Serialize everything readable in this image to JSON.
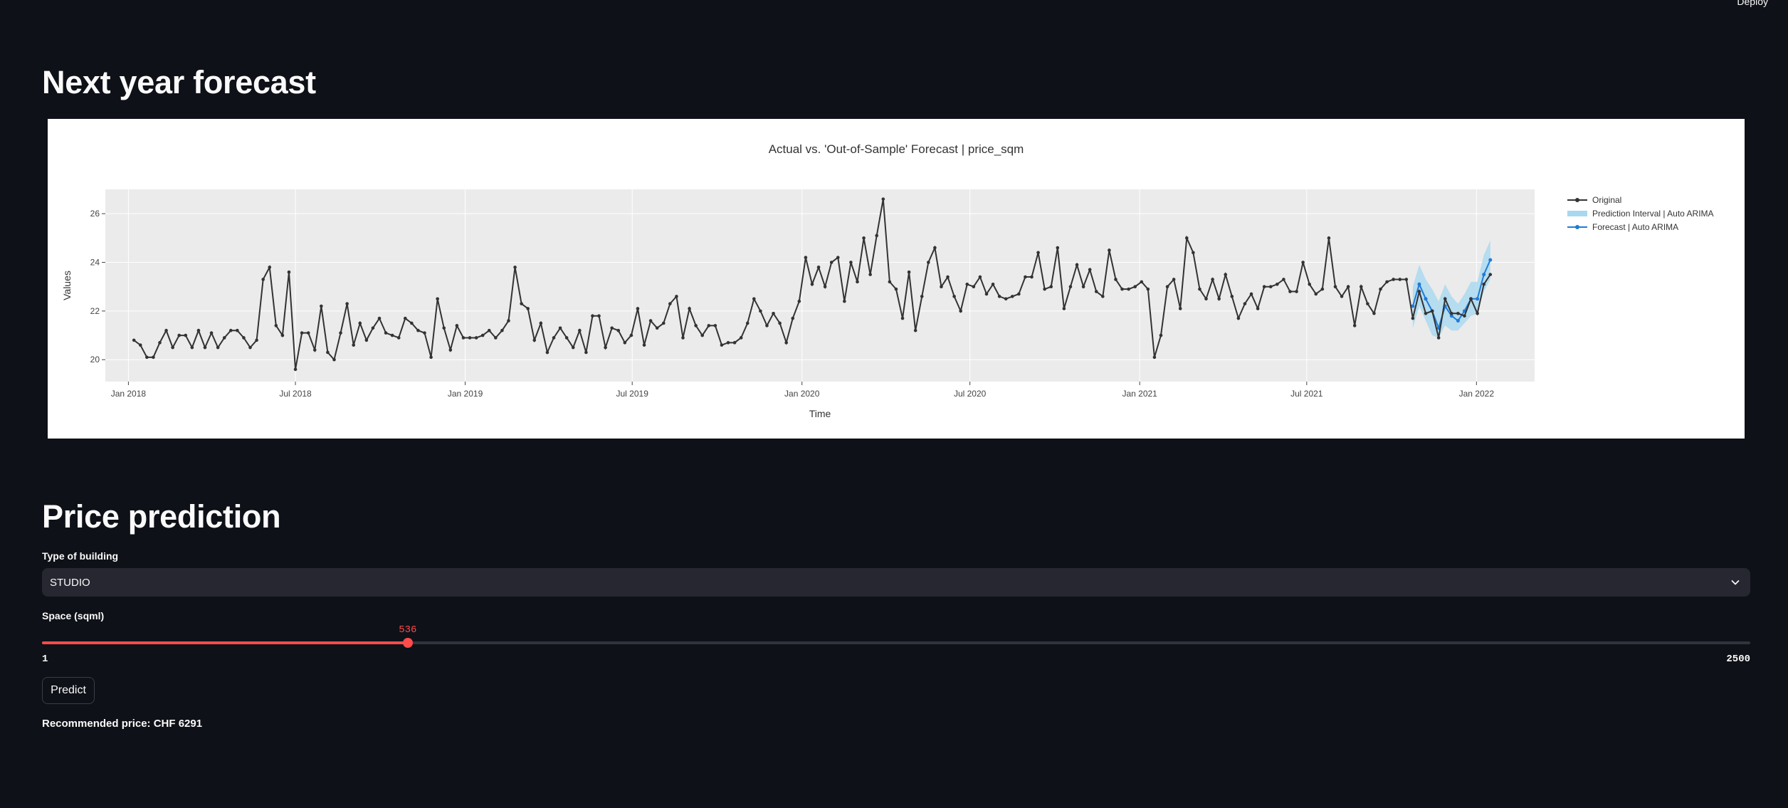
{
  "header": {
    "deploy_label": "Deploy"
  },
  "forecast_section": {
    "title": "Next year forecast"
  },
  "chart_data": {
    "type": "line",
    "title": "Actual vs. 'Out-of-Sample' Forecast | price_sqm",
    "xlabel": "Time",
    "ylabel": "Values",
    "x_ticks": [
      "Jan 2018",
      "Jul 2018",
      "Jan 2019",
      "Jul 2019",
      "Jan 2020",
      "Jul 2020",
      "Jan 2021",
      "Jul 2021",
      "Jan 2022"
    ],
    "y_ticks": [
      20,
      22,
      24,
      26
    ],
    "ylim": [
      19.1,
      27.0
    ],
    "xlim": [
      "2017-12-07",
      "2022-03-05"
    ],
    "x_unit": "week",
    "grid": true,
    "legend_position": "top-right",
    "legend_entries": [
      "Original",
      "Prediction Interval | Auto ARIMA",
      "Forecast | Auto ARIMA"
    ],
    "colors": {
      "original": "#333333",
      "interval": "#a8d8f0",
      "forecast": "#1f7bd8",
      "plot_bg": "#ebebeb"
    },
    "series": [
      {
        "name": "Original",
        "start": "2018-01-07",
        "values": [
          20.8,
          20.6,
          20.1,
          20.1,
          20.7,
          21.2,
          20.5,
          21.0,
          21.0,
          20.5,
          21.2,
          20.5,
          21.1,
          20.5,
          20.9,
          21.2,
          21.2,
          20.9,
          20.5,
          20.8,
          23.3,
          23.8,
          21.4,
          21.0,
          23.6,
          19.6,
          21.1,
          21.1,
          20.4,
          22.2,
          20.3,
          20.0,
          21.1,
          22.3,
          20.6,
          21.5,
          20.8,
          21.3,
          21.7,
          21.1,
          21.0,
          20.9,
          21.7,
          21.5,
          21.2,
          21.1,
          20.1,
          22.5,
          21.3,
          20.4,
          21.4,
          20.9,
          20.9,
          20.9,
          21.0,
          21.2,
          20.9,
          21.2,
          21.6,
          23.8,
          22.3,
          22.1,
          20.8,
          21.5,
          20.3,
          20.9,
          21.3,
          20.9,
          20.5,
          21.2,
          20.3,
          21.8,
          21.8,
          20.5,
          21.3,
          21.2,
          20.7,
          21.0,
          22.1,
          20.6,
          21.6,
          21.3,
          21.5,
          22.3,
          22.6,
          20.9,
          22.1,
          21.4,
          21.0,
          21.4,
          21.4,
          20.6,
          20.7,
          20.7,
          20.9,
          21.5,
          22.5,
          22.0,
          21.4,
          21.9,
          21.5,
          20.7,
          21.7,
          22.4,
          24.2,
          23.1,
          23.8,
          23.0,
          24.0,
          24.2,
          22.4,
          24.0,
          23.2,
          25.0,
          23.5,
          25.1,
          26.6,
          23.2,
          22.9,
          21.7,
          23.6,
          21.2,
          22.6,
          24.0,
          24.6,
          23.0,
          23.4,
          22.6,
          22.0,
          23.1,
          23.0,
          23.4,
          22.7,
          23.1,
          22.6,
          22.5,
          22.6,
          22.7,
          23.4,
          23.4,
          24.4,
          22.9,
          23.0,
          24.6,
          22.1,
          23.0,
          23.9,
          23.0,
          23.7,
          22.8,
          22.6,
          24.5,
          23.3,
          22.9,
          22.9,
          23.0,
          23.2,
          22.9,
          20.1,
          21.0,
          23.0,
          23.3,
          22.1,
          25.0,
          24.4,
          22.9,
          22.5,
          23.3,
          22.5,
          23.5,
          22.6,
          21.7,
          22.3,
          22.7,
          22.1,
          23.0,
          23.0,
          23.1,
          23.3,
          22.8,
          22.8,
          24.0,
          23.1,
          22.7,
          22.9,
          25.0,
          23.0,
          22.6,
          23.0,
          21.4,
          23.0,
          22.3,
          21.9,
          22.9,
          23.2,
          23.3,
          23.3,
          23.3,
          21.7,
          22.8,
          21.9,
          22.0,
          20.9,
          22.5,
          21.9,
          21.9,
          21.8,
          22.5,
          21.9,
          23.1,
          23.5
        ]
      },
      {
        "name": "Forecast | Auto ARIMA",
        "start": "2021-10-24",
        "values": [
          22.2,
          23.1,
          22.5,
          22.0,
          21.3,
          22.2,
          21.8,
          21.6,
          22.0,
          22.5,
          22.5,
          23.5,
          24.1
        ],
        "lower": [
          21.3,
          22.2,
          21.6,
          21.0,
          20.9,
          21.4,
          21.2,
          21.2,
          21.5,
          21.8,
          21.9,
          22.8,
          23.3
        ],
        "upper": [
          23.0,
          23.9,
          23.3,
          22.9,
          22.4,
          23.1,
          22.6,
          22.3,
          22.7,
          23.2,
          23.2,
          24.3,
          24.9
        ]
      }
    ]
  },
  "price_section": {
    "title": "Price prediction",
    "building_label": "Type of building",
    "building_value": "STUDIO",
    "space_label": "Space (sqml)",
    "space_value": 536,
    "space_min": 1,
    "space_max": 2500,
    "predict_label": "Predict",
    "result_prefix": "Recommended price:",
    "result_value": "CHF 6291"
  },
  "icons": {
    "select_chevron": "chevron-down-icon"
  },
  "theme": {
    "accent": "#ff4b4b",
    "background": "#0e1117",
    "widget_bg": "#262730"
  }
}
